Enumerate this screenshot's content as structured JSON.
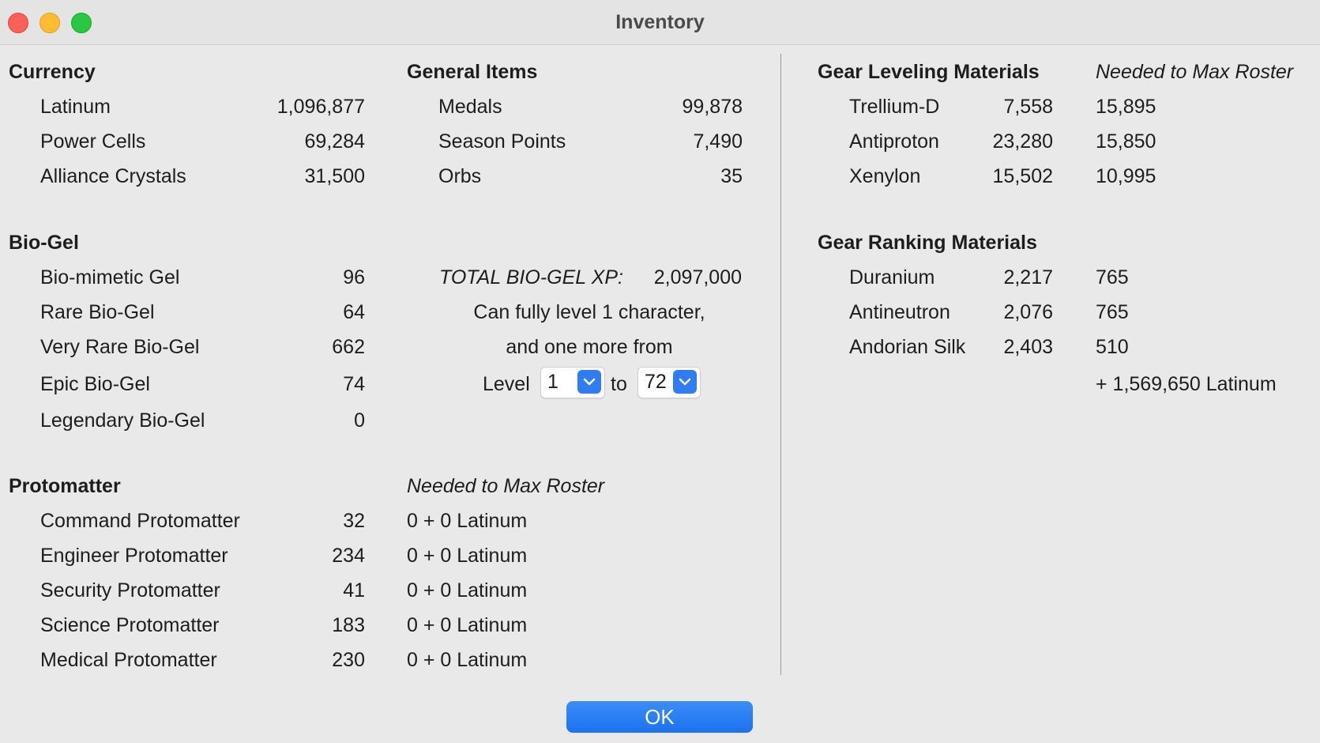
{
  "window": {
    "title": "Inventory"
  },
  "currency": {
    "heading": "Currency",
    "rows": [
      {
        "name": "Latinum",
        "value": "1,096,877"
      },
      {
        "name": "Power Cells",
        "value": "69,284"
      },
      {
        "name": "Alliance Crystals",
        "value": "31,500"
      }
    ]
  },
  "general": {
    "heading": "General Items",
    "rows": [
      {
        "name": "Medals",
        "value": "99,878"
      },
      {
        "name": "Season Points",
        "value": "7,490"
      },
      {
        "name": "Orbs",
        "value": "35"
      }
    ]
  },
  "biogel": {
    "heading": "Bio-Gel",
    "rows": [
      {
        "name": "Bio-mimetic Gel",
        "value": "96"
      },
      {
        "name": "Rare Bio-Gel",
        "value": "64"
      },
      {
        "name": "Very Rare Bio-Gel",
        "value": "662"
      },
      {
        "name": "Epic Bio-Gel",
        "value": "74"
      },
      {
        "name": "Legendary Bio-Gel",
        "value": "0"
      }
    ],
    "total_label": "TOTAL BIO-GEL XP:",
    "total_value": "2,097,000",
    "line1": "Can fully level 1 character,",
    "line2": "and one more from",
    "level_label": "Level",
    "level_from": "1",
    "to_label": "to",
    "level_to": "72"
  },
  "protomatter": {
    "heading": "Protomatter",
    "needed_heading": "Needed to Max Roster",
    "rows": [
      {
        "name": "Command Protomatter",
        "value": "32",
        "needed": "0 + 0 Latinum"
      },
      {
        "name": "Engineer Protomatter",
        "value": "234",
        "needed": "0 + 0 Latinum"
      },
      {
        "name": "Security Protomatter",
        "value": "41",
        "needed": "0 + 0 Latinum"
      },
      {
        "name": "Science Protomatter",
        "value": "183",
        "needed": "0 + 0 Latinum"
      },
      {
        "name": "Medical Protomatter",
        "value": "230",
        "needed": "0 + 0 Latinum"
      }
    ]
  },
  "gear_leveling": {
    "heading": "Gear Leveling Materials",
    "needed_heading": "Needed to Max Roster",
    "rows": [
      {
        "name": "Trellium-D",
        "value": "7,558",
        "needed": "15,895"
      },
      {
        "name": "Antiproton",
        "value": "23,280",
        "needed": "15,850"
      },
      {
        "name": "Xenylon",
        "value": "15,502",
        "needed": "10,995"
      }
    ]
  },
  "gear_ranking": {
    "heading": "Gear Ranking Materials",
    "rows": [
      {
        "name": "Duranium",
        "value": "2,217",
        "needed": "765"
      },
      {
        "name": "Antineutron",
        "value": "2,076",
        "needed": "765"
      },
      {
        "name": "Andorian Silk",
        "value": "2,403",
        "needed": "510"
      }
    ],
    "extra": "+ 1,569,650 Latinum"
  },
  "buttons": {
    "ok": "OK"
  }
}
